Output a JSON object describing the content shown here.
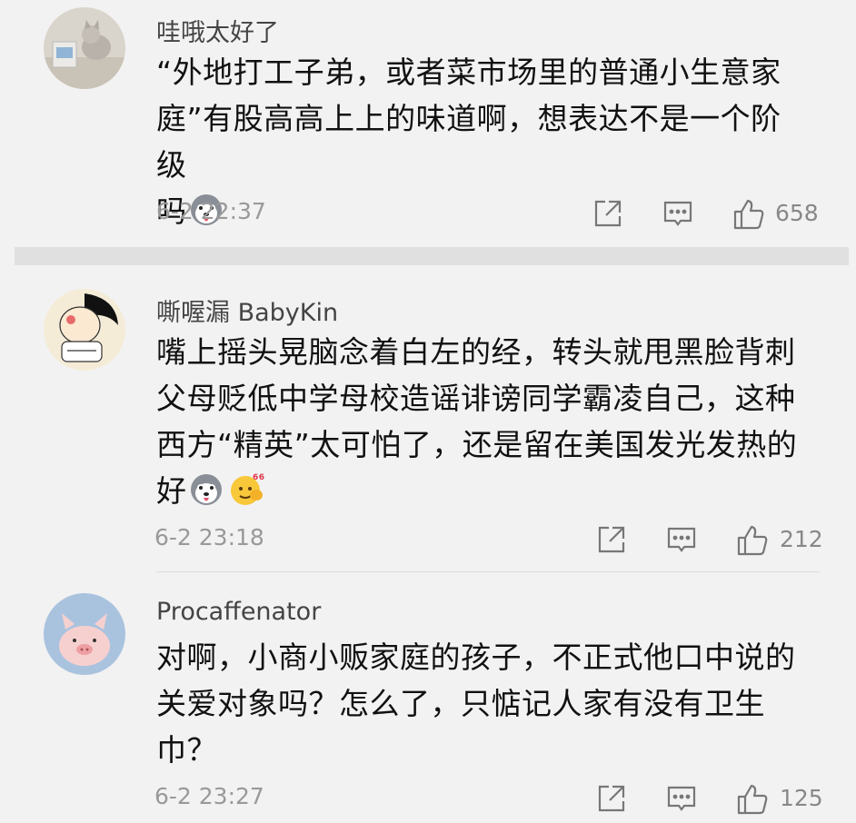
{
  "comments": [
    {
      "username": "哇哦太好了",
      "lines": [
        "“外地打工子弟，或者菜市场里的普通小生意家",
        "庭”有股高高上上的味道啊，想表达不是一个阶级",
        "吗"
      ],
      "time": "6-2 22:37",
      "likes": "658",
      "emojis": [
        "husky-emoji"
      ]
    },
    {
      "username": "嘶喔漏 BabyKin",
      "lines": [
        "嘴上摇头晃脑念着白左的经，转头就甩黑脸背刺",
        "父母贬低中学母校造谣诽谤同学霸凌自己，这种",
        "西方“精英”太可怕了，还是留在美国发光发热的",
        "好"
      ],
      "time": "6-2 23:18",
      "likes": "212",
      "emojis": [
        "husky-emoji",
        "666-emoji"
      ]
    },
    {
      "username": "Procaffenator",
      "lines": [
        "对啊，小商小贩家庭的孩子，不正式他口中说的",
        "关爱对象吗？怎么了，只惦记人家有没有卫生",
        "巾？"
      ],
      "time": "6-2 23:27",
      "likes": "125",
      "emojis": []
    }
  ],
  "icons": {
    "share": "share-icon",
    "reply": "comment-icon",
    "like": "thumbs-up-icon"
  },
  "colors": {
    "background": "#f2f2f2",
    "text": "#111111",
    "meta": "#999999"
  }
}
